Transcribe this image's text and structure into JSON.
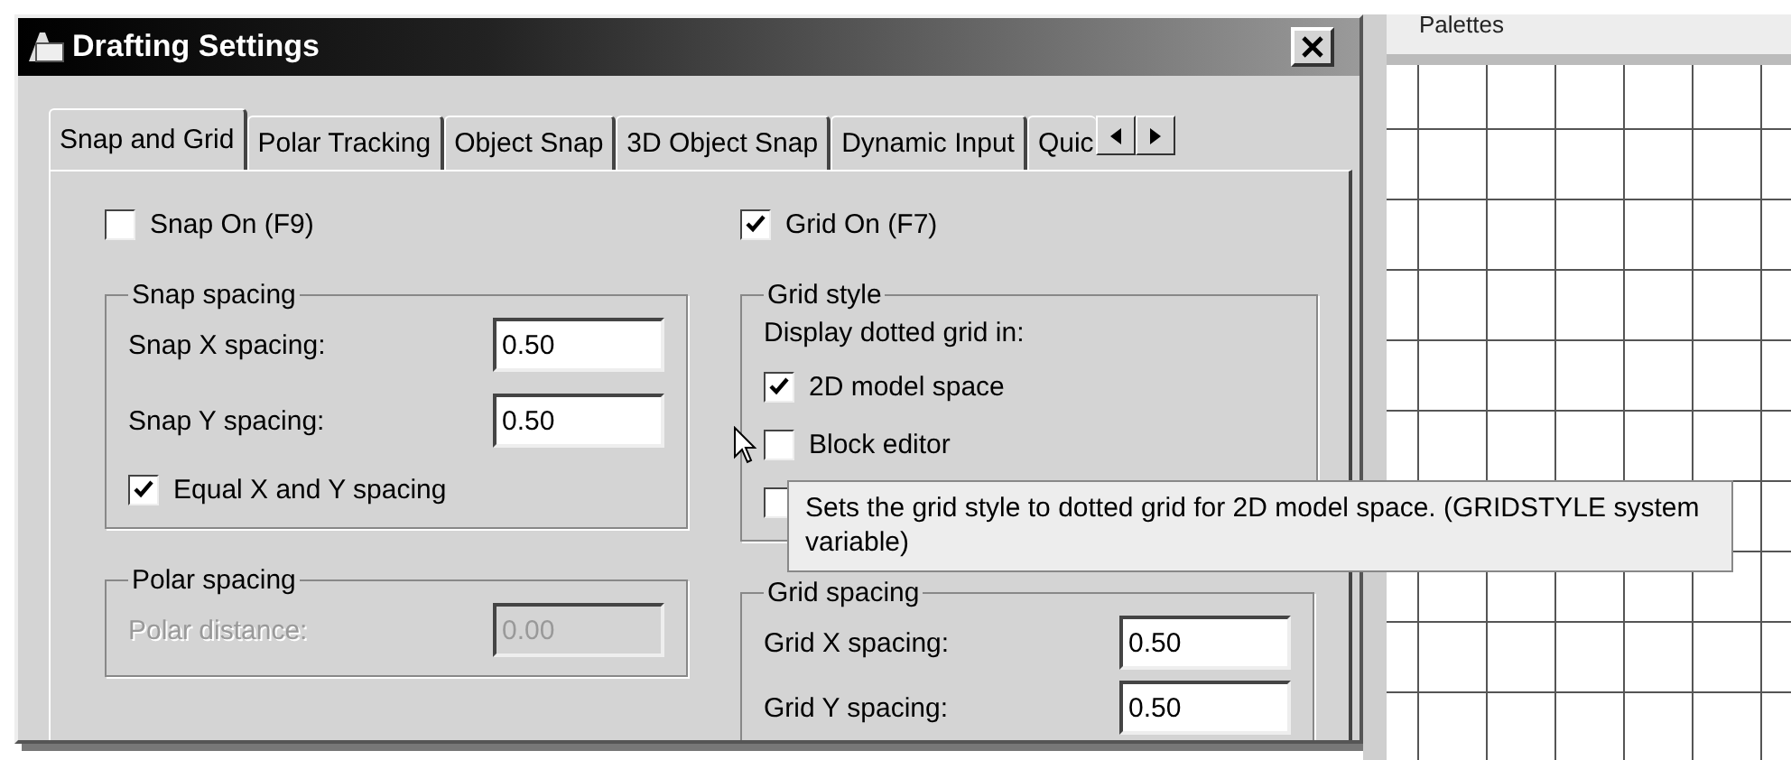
{
  "window": {
    "title": "Drafting Settings"
  },
  "tabs": [
    {
      "label": "Snap and Grid",
      "selected": true
    },
    {
      "label": "Polar Tracking",
      "selected": false
    },
    {
      "label": "Object Snap",
      "selected": false
    },
    {
      "label": "3D Object Snap",
      "selected": false
    },
    {
      "label": "Dynamic Input",
      "selected": false
    },
    {
      "label": "Quic",
      "selected": false
    }
  ],
  "snap_on": {
    "label": "Snap On (F9)",
    "checked": false
  },
  "snap_spacing": {
    "title": "Snap spacing",
    "fields": [
      {
        "label": "Snap X spacing:",
        "value": "0.50",
        "disabled": false
      },
      {
        "label": "Snap Y spacing:",
        "value": "0.50",
        "disabled": false
      }
    ],
    "equal": {
      "label": "Equal X and Y spacing",
      "checked": true
    }
  },
  "polar_spacing": {
    "title": "Polar spacing",
    "fields": [
      {
        "label": "Polar distance:",
        "value": "0.00",
        "disabled": true
      }
    ]
  },
  "grid_on": {
    "label": "Grid On (F7)",
    "checked": true
  },
  "grid_style": {
    "title": "Grid style",
    "caption": "Display dotted grid in:",
    "options": [
      {
        "label": "2D model space",
        "checked": true
      },
      {
        "label": "Block editor",
        "checked": false
      },
      {
        "checked": false
      }
    ]
  },
  "grid_spacing": {
    "title": "Grid spacing",
    "fields": [
      {
        "label": "Grid X spacing:",
        "value": "0.50",
        "disabled": false
      },
      {
        "label": "Grid Y spacing:",
        "value": "0.50",
        "disabled": false
      }
    ]
  },
  "tooltip": {
    "text": "Sets the grid style to dotted grid for 2D model space. (GRIDSTYLE system variable)"
  },
  "palette": {
    "title": "Palettes"
  }
}
